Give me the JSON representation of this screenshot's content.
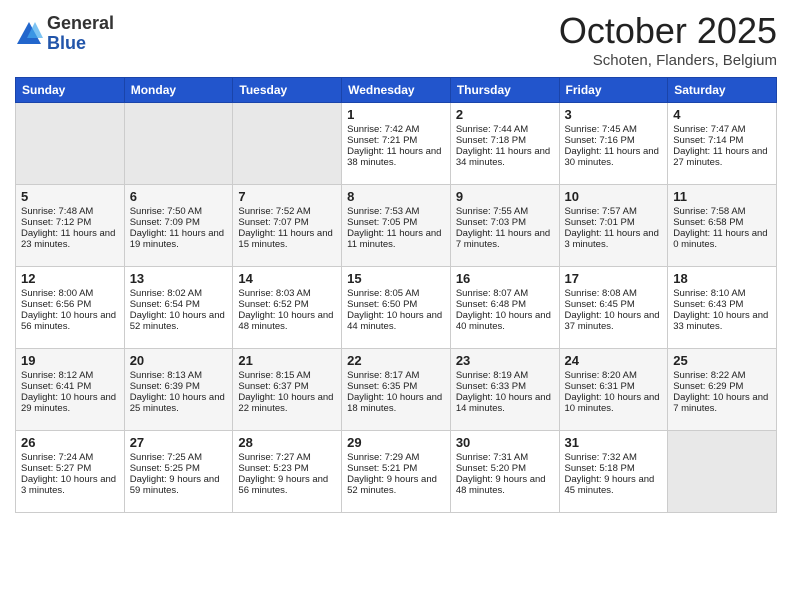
{
  "header": {
    "logo_general": "General",
    "logo_blue": "Blue",
    "month_title": "October 2025",
    "location": "Schoten, Flanders, Belgium"
  },
  "days_of_week": [
    "Sunday",
    "Monday",
    "Tuesday",
    "Wednesday",
    "Thursday",
    "Friday",
    "Saturday"
  ],
  "weeks": [
    [
      {
        "day": "",
        "empty": true
      },
      {
        "day": "",
        "empty": true
      },
      {
        "day": "",
        "empty": true
      },
      {
        "day": "1",
        "sunrise": "Sunrise: 7:42 AM",
        "sunset": "Sunset: 7:21 PM",
        "daylight": "Daylight: 11 hours and 38 minutes."
      },
      {
        "day": "2",
        "sunrise": "Sunrise: 7:44 AM",
        "sunset": "Sunset: 7:18 PM",
        "daylight": "Daylight: 11 hours and 34 minutes."
      },
      {
        "day": "3",
        "sunrise": "Sunrise: 7:45 AM",
        "sunset": "Sunset: 7:16 PM",
        "daylight": "Daylight: 11 hours and 30 minutes."
      },
      {
        "day": "4",
        "sunrise": "Sunrise: 7:47 AM",
        "sunset": "Sunset: 7:14 PM",
        "daylight": "Daylight: 11 hours and 27 minutes."
      }
    ],
    [
      {
        "day": "5",
        "sunrise": "Sunrise: 7:48 AM",
        "sunset": "Sunset: 7:12 PM",
        "daylight": "Daylight: 11 hours and 23 minutes."
      },
      {
        "day": "6",
        "sunrise": "Sunrise: 7:50 AM",
        "sunset": "Sunset: 7:09 PM",
        "daylight": "Daylight: 11 hours and 19 minutes."
      },
      {
        "day": "7",
        "sunrise": "Sunrise: 7:52 AM",
        "sunset": "Sunset: 7:07 PM",
        "daylight": "Daylight: 11 hours and 15 minutes."
      },
      {
        "day": "8",
        "sunrise": "Sunrise: 7:53 AM",
        "sunset": "Sunset: 7:05 PM",
        "daylight": "Daylight: 11 hours and 11 minutes."
      },
      {
        "day": "9",
        "sunrise": "Sunrise: 7:55 AM",
        "sunset": "Sunset: 7:03 PM",
        "daylight": "Daylight: 11 hours and 7 minutes."
      },
      {
        "day": "10",
        "sunrise": "Sunrise: 7:57 AM",
        "sunset": "Sunset: 7:01 PM",
        "daylight": "Daylight: 11 hours and 3 minutes."
      },
      {
        "day": "11",
        "sunrise": "Sunrise: 7:58 AM",
        "sunset": "Sunset: 6:58 PM",
        "daylight": "Daylight: 11 hours and 0 minutes."
      }
    ],
    [
      {
        "day": "12",
        "sunrise": "Sunrise: 8:00 AM",
        "sunset": "Sunset: 6:56 PM",
        "daylight": "Daylight: 10 hours and 56 minutes."
      },
      {
        "day": "13",
        "sunrise": "Sunrise: 8:02 AM",
        "sunset": "Sunset: 6:54 PM",
        "daylight": "Daylight: 10 hours and 52 minutes."
      },
      {
        "day": "14",
        "sunrise": "Sunrise: 8:03 AM",
        "sunset": "Sunset: 6:52 PM",
        "daylight": "Daylight: 10 hours and 48 minutes."
      },
      {
        "day": "15",
        "sunrise": "Sunrise: 8:05 AM",
        "sunset": "Sunset: 6:50 PM",
        "daylight": "Daylight: 10 hours and 44 minutes."
      },
      {
        "day": "16",
        "sunrise": "Sunrise: 8:07 AM",
        "sunset": "Sunset: 6:48 PM",
        "daylight": "Daylight: 10 hours and 40 minutes."
      },
      {
        "day": "17",
        "sunrise": "Sunrise: 8:08 AM",
        "sunset": "Sunset: 6:45 PM",
        "daylight": "Daylight: 10 hours and 37 minutes."
      },
      {
        "day": "18",
        "sunrise": "Sunrise: 8:10 AM",
        "sunset": "Sunset: 6:43 PM",
        "daylight": "Daylight: 10 hours and 33 minutes."
      }
    ],
    [
      {
        "day": "19",
        "sunrise": "Sunrise: 8:12 AM",
        "sunset": "Sunset: 6:41 PM",
        "daylight": "Daylight: 10 hours and 29 minutes."
      },
      {
        "day": "20",
        "sunrise": "Sunrise: 8:13 AM",
        "sunset": "Sunset: 6:39 PM",
        "daylight": "Daylight: 10 hours and 25 minutes."
      },
      {
        "day": "21",
        "sunrise": "Sunrise: 8:15 AM",
        "sunset": "Sunset: 6:37 PM",
        "daylight": "Daylight: 10 hours and 22 minutes."
      },
      {
        "day": "22",
        "sunrise": "Sunrise: 8:17 AM",
        "sunset": "Sunset: 6:35 PM",
        "daylight": "Daylight: 10 hours and 18 minutes."
      },
      {
        "day": "23",
        "sunrise": "Sunrise: 8:19 AM",
        "sunset": "Sunset: 6:33 PM",
        "daylight": "Daylight: 10 hours and 14 minutes."
      },
      {
        "day": "24",
        "sunrise": "Sunrise: 8:20 AM",
        "sunset": "Sunset: 6:31 PM",
        "daylight": "Daylight: 10 hours and 10 minutes."
      },
      {
        "day": "25",
        "sunrise": "Sunrise: 8:22 AM",
        "sunset": "Sunset: 6:29 PM",
        "daylight": "Daylight: 10 hours and 7 minutes."
      }
    ],
    [
      {
        "day": "26",
        "sunrise": "Sunrise: 7:24 AM",
        "sunset": "Sunset: 5:27 PM",
        "daylight": "Daylight: 10 hours and 3 minutes."
      },
      {
        "day": "27",
        "sunrise": "Sunrise: 7:25 AM",
        "sunset": "Sunset: 5:25 PM",
        "daylight": "Daylight: 9 hours and 59 minutes."
      },
      {
        "day": "28",
        "sunrise": "Sunrise: 7:27 AM",
        "sunset": "Sunset: 5:23 PM",
        "daylight": "Daylight: 9 hours and 56 minutes."
      },
      {
        "day": "29",
        "sunrise": "Sunrise: 7:29 AM",
        "sunset": "Sunset: 5:21 PM",
        "daylight": "Daylight: 9 hours and 52 minutes."
      },
      {
        "day": "30",
        "sunrise": "Sunrise: 7:31 AM",
        "sunset": "Sunset: 5:20 PM",
        "daylight": "Daylight: 9 hours and 48 minutes."
      },
      {
        "day": "31",
        "sunrise": "Sunrise: 7:32 AM",
        "sunset": "Sunset: 5:18 PM",
        "daylight": "Daylight: 9 hours and 45 minutes."
      },
      {
        "day": "",
        "empty": true
      }
    ]
  ]
}
